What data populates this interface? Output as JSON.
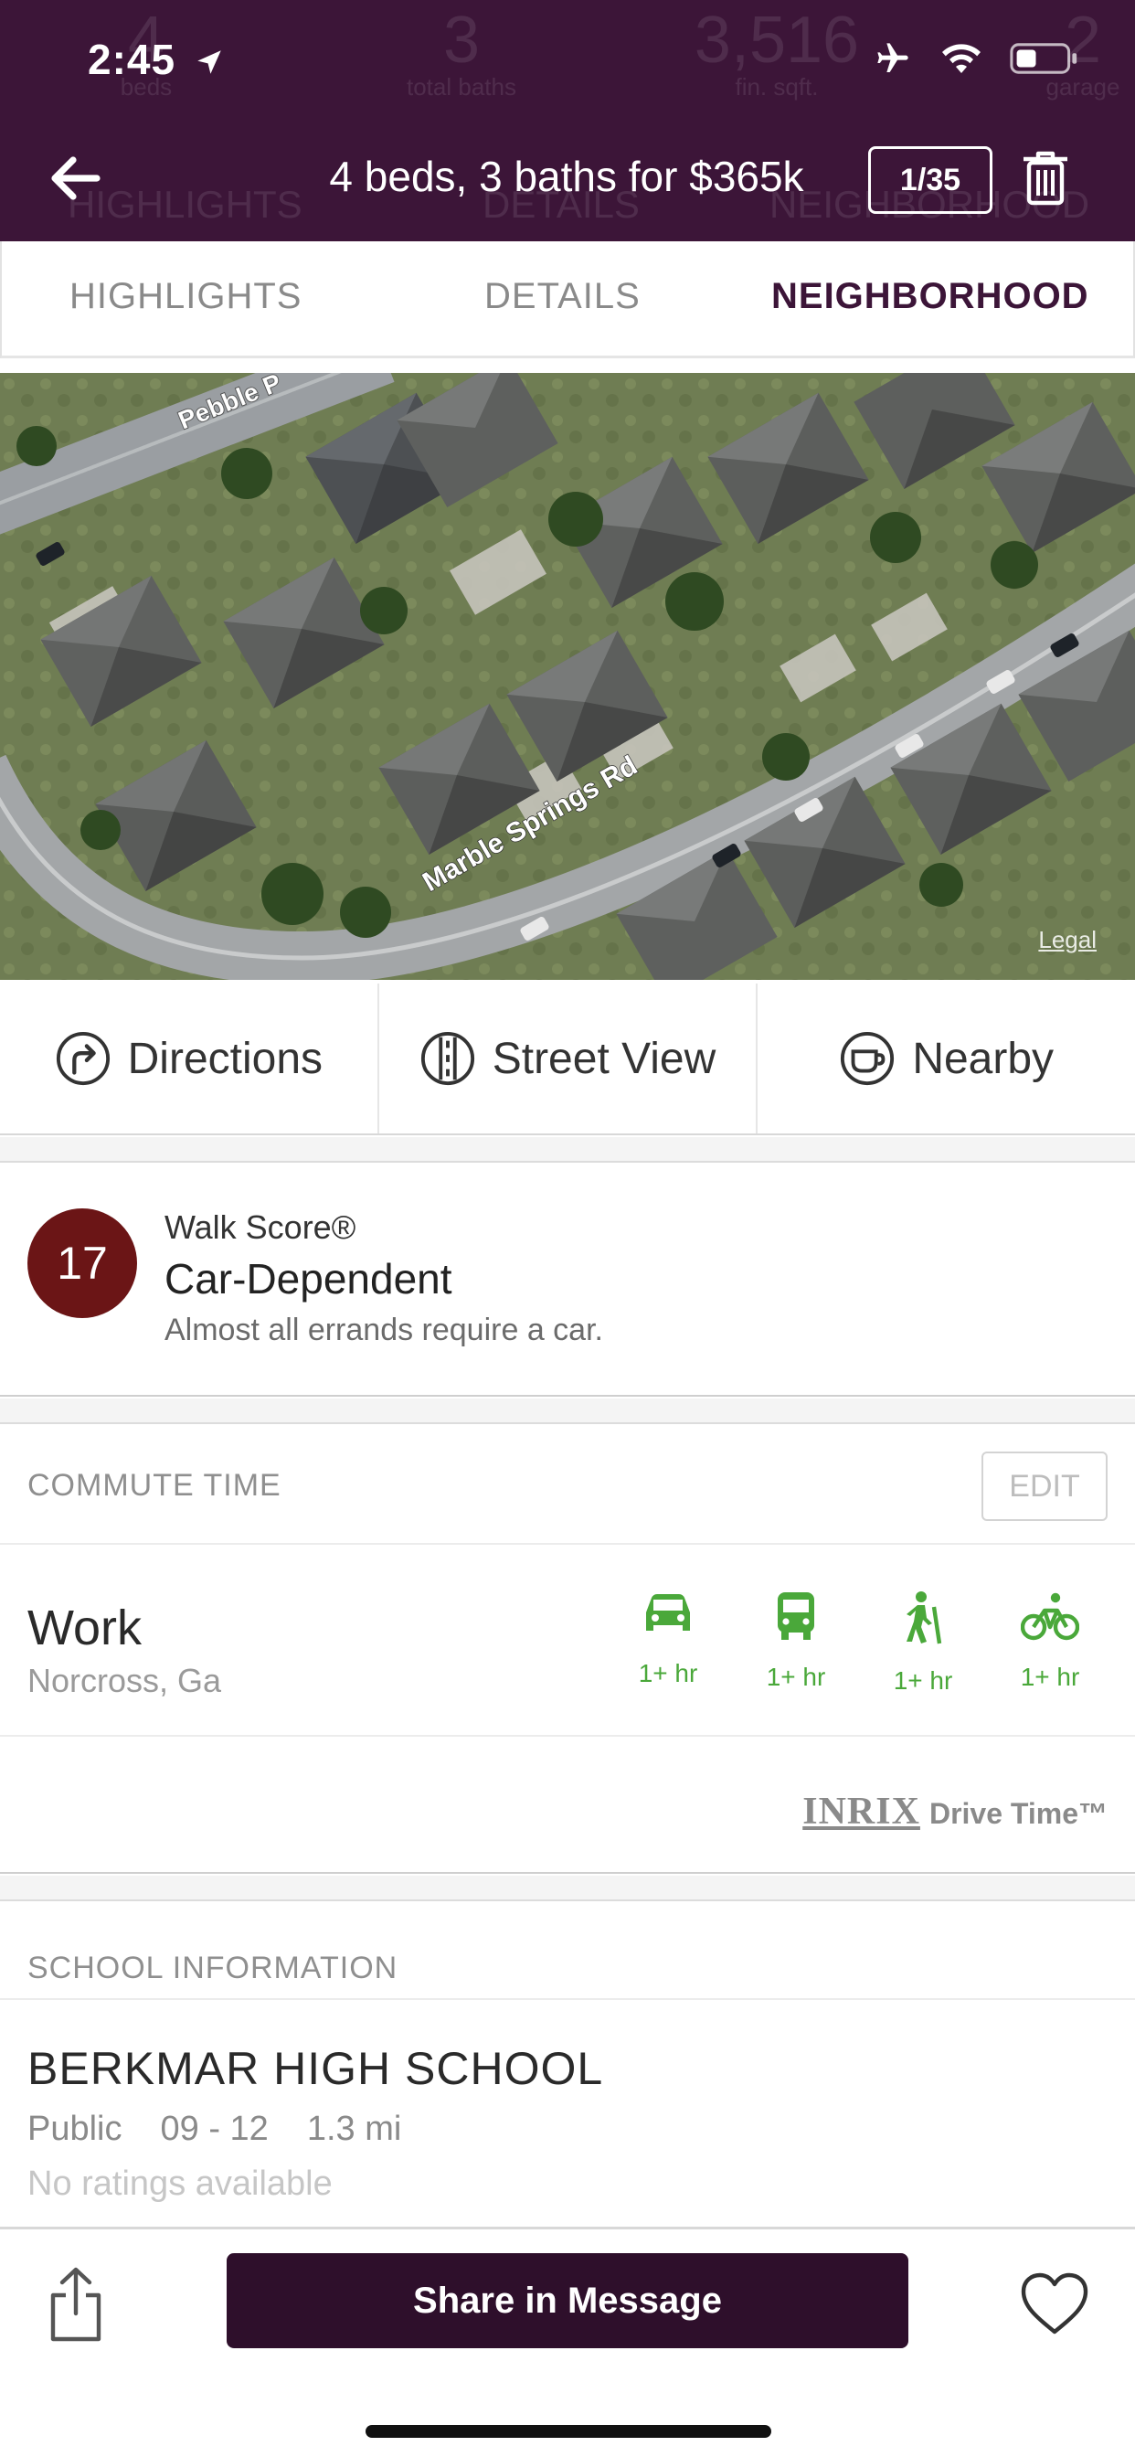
{
  "status_bar": {
    "time": "2:45"
  },
  "header_bg_stats": [
    {
      "value": "4",
      "label": "beds"
    },
    {
      "value": "3",
      "label": "total baths"
    },
    {
      "value": "3,516",
      "label": "fin. sqft."
    },
    {
      "value": "2",
      "label": "garage"
    }
  ],
  "header": {
    "title": "4 beds, 3 baths for $365k",
    "photo_counter": "1/35"
  },
  "tabs": [
    {
      "label": "HIGHLIGHTS"
    },
    {
      "label": "DETAILS"
    },
    {
      "label": "NEIGHBORHOOD"
    }
  ],
  "map": {
    "street_labels": [
      "Pebble P",
      "Marble Springs Rd"
    ],
    "legal": "Legal"
  },
  "actions": [
    {
      "label": "Directions",
      "icon": "directions-icon"
    },
    {
      "label": "Street View",
      "icon": "street-view-icon"
    },
    {
      "label": "Nearby",
      "icon": "coffee-cup-icon"
    }
  ],
  "walk_score": {
    "score": "17",
    "label": "Walk Score®",
    "title": "Car-Dependent",
    "description": "Almost all errands require a car."
  },
  "commute": {
    "section_title": "COMMUTE TIME",
    "edit_label": "EDIT",
    "destination": "Work",
    "location": "Norcross, Ga",
    "modes": [
      {
        "icon": "car-icon",
        "time": "1+ hr"
      },
      {
        "icon": "bus-icon",
        "time": "1+ hr"
      },
      {
        "icon": "walk-icon",
        "time": "1+ hr"
      },
      {
        "icon": "bike-icon",
        "time": "1+ hr"
      }
    ],
    "provider": {
      "brand": "INRIX",
      "product": "Drive Time™"
    }
  },
  "school": {
    "section_title": "SCHOOL INFORMATION",
    "name": "BERKMAR HIGH SCHOOL",
    "type": "Public",
    "grades": "09 - 12",
    "distance": "1.3 mi",
    "rating": "No ratings available"
  },
  "bottom_bar": {
    "share_message_label": "Share in Message"
  },
  "colors": {
    "brand_plum": "#3c1538",
    "button_plum": "#2e0f2b",
    "walk_score_red": "#6b1516",
    "commute_green": "#4aa83a"
  }
}
